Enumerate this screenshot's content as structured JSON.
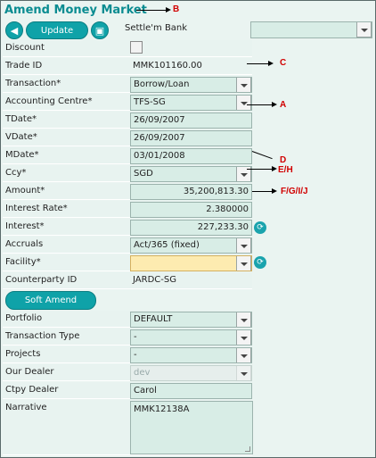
{
  "title": "Amend Money Market",
  "toolbar": {
    "back_icon": "arrow-left",
    "update_label": "Update",
    "doc_icon": "document",
    "settle_label": "Settle'm Bank",
    "settle_value": ""
  },
  "annotations": {
    "b": "B",
    "c": "C",
    "a": "A",
    "d": "D",
    "eh": "E/H",
    "fgij": "F/G/I/J"
  },
  "fields": {
    "discount": {
      "label": "Discount"
    },
    "trade_id": {
      "label": "Trade ID",
      "value": "MMK101160.00"
    },
    "transaction": {
      "label": "Transaction*",
      "value": "Borrow/Loan"
    },
    "accounting_centre": {
      "label": "Accounting Centre*",
      "value": "TFS-SG"
    },
    "tdate": {
      "label": "TDate*",
      "value": "26/09/2007"
    },
    "vdate": {
      "label": "VDate*",
      "value": "26/09/2007"
    },
    "mdate": {
      "label": "MDate*",
      "value": "03/01/2008"
    },
    "ccy": {
      "label": "Ccy*",
      "value": "SGD"
    },
    "amount": {
      "label": "Amount*",
      "value": "35,200,813.30"
    },
    "interest_rate": {
      "label": "Interest Rate*",
      "value": "2.380000"
    },
    "interest": {
      "label": "Interest*",
      "value": "227,233.30"
    },
    "accruals": {
      "label": "Accruals",
      "value": "Act/365 (fixed)"
    },
    "facility": {
      "label": "Facility*",
      "value": ""
    },
    "counterparty_id": {
      "label": "Counterparty ID",
      "value": "JARDC-SG"
    }
  },
  "soft_amend_label": "Soft Amend",
  "fields2": {
    "portfolio": {
      "label": "Portfolio",
      "value": "DEFAULT"
    },
    "transaction_type": {
      "label": "Transaction Type",
      "value": "-"
    },
    "projects": {
      "label": "Projects",
      "value": "-"
    },
    "our_dealer": {
      "label": "Our Dealer",
      "value": "dev"
    },
    "ctpy_dealer": {
      "label": "Ctpy Dealer",
      "value": "Carol"
    },
    "narrative": {
      "label": "Narrative",
      "value": "MMK12138A"
    }
  },
  "colors": {
    "accent": "#0fa2a8",
    "title": "#0a8c91",
    "annotation": "#d10000",
    "field_bg": "#d8ede6",
    "facility_bg": "#fdebb0"
  }
}
